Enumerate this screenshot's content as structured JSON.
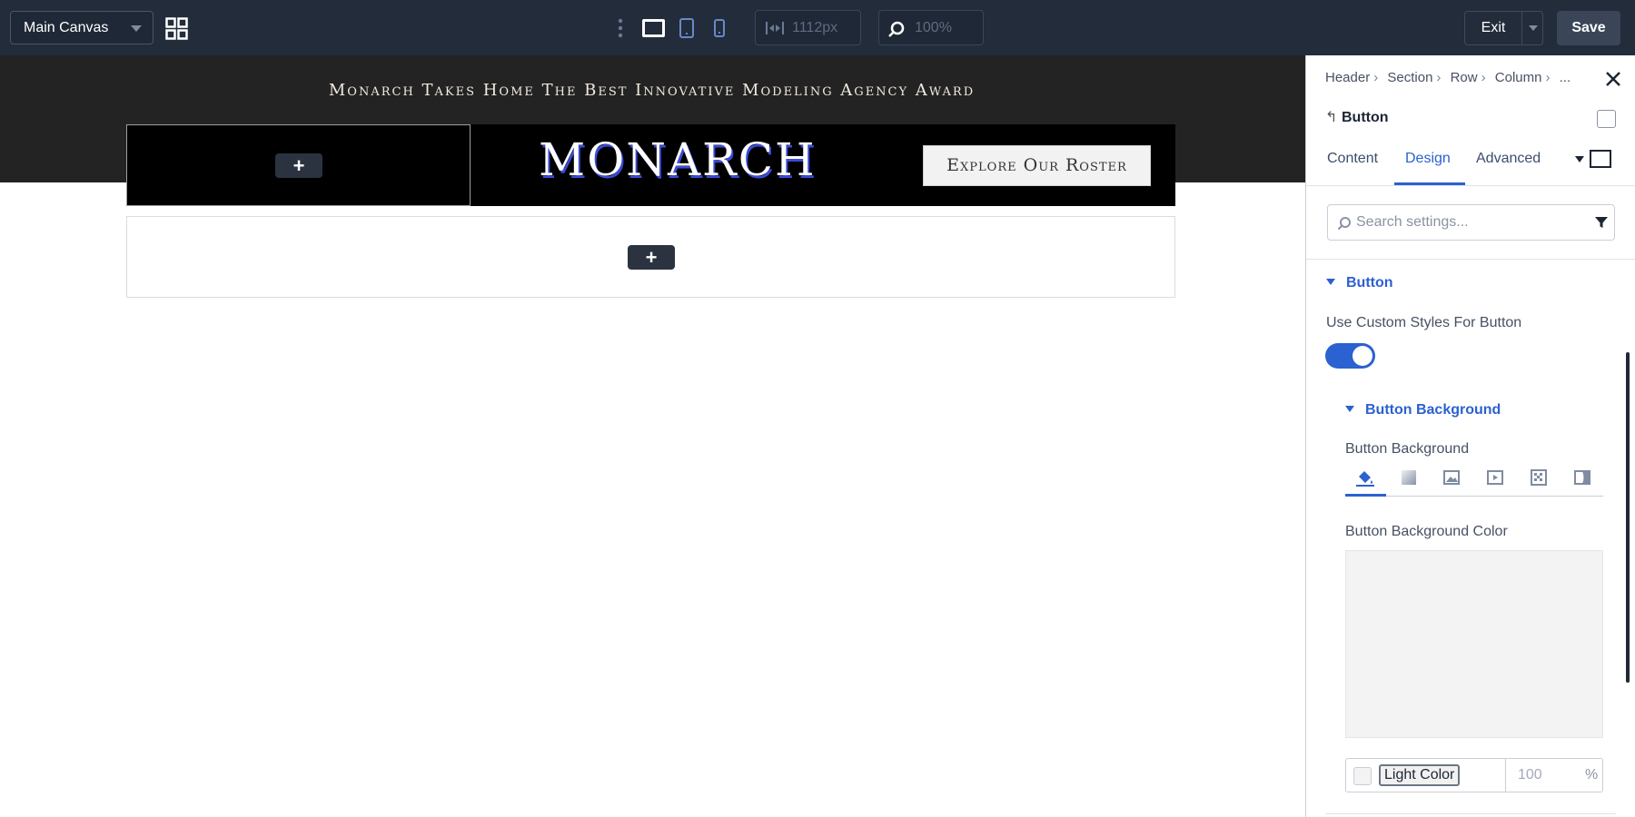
{
  "topbar": {
    "canvas_select": "Main Canvas",
    "width_value": "1112px",
    "zoom_value": "100%",
    "exit_label": "Exit",
    "save_label": "Save"
  },
  "canvas": {
    "announcement": "Monarch Takes Home The Best Innovative Modeling Agency Award",
    "logo_text": "MONARCH",
    "cta_label": "Explore Our Roster",
    "add_symbol": "+"
  },
  "panel": {
    "breadcrumb": [
      "Header",
      "Section",
      "Row",
      "Column",
      "..."
    ],
    "element_title": "Button",
    "tabs": [
      "Content",
      "Design",
      "Advanced"
    ],
    "active_tab": "Design",
    "search_placeholder": "Search settings...",
    "section_button": "Button",
    "custom_styles_label": "Use Custom Styles For Button",
    "custom_styles_enabled": true,
    "subsection_bg": "Button Background",
    "bg_label": "Button Background",
    "bg_types": [
      "paint-bucket-icon",
      "gradient-icon",
      "image-icon",
      "video-icon",
      "pattern-icon",
      "mask-icon"
    ],
    "bg_color_label": "Button Background Color",
    "color_name": "Light Color",
    "opacity_value": "100",
    "opacity_unit": "%"
  },
  "colors": {
    "topbar_bg": "#232c3b",
    "accent": "#2b61d1",
    "dark_band": "#232323",
    "preview_bg": "#f3f3f3"
  }
}
